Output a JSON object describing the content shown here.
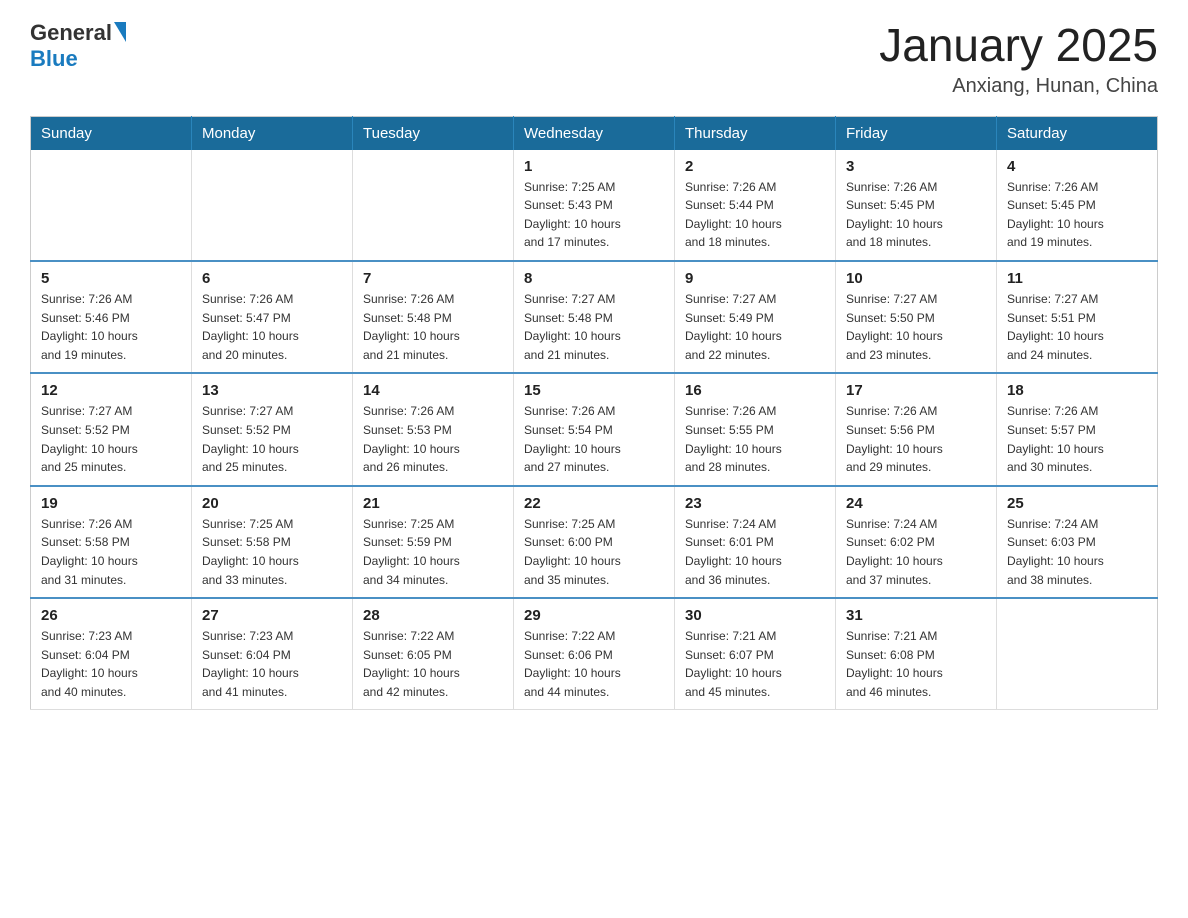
{
  "header": {
    "logo_general": "General",
    "logo_blue": "Blue",
    "title": "January 2025",
    "subtitle": "Anxiang, Hunan, China"
  },
  "days_of_week": [
    "Sunday",
    "Monday",
    "Tuesday",
    "Wednesday",
    "Thursday",
    "Friday",
    "Saturday"
  ],
  "weeks": [
    [
      {
        "day": "",
        "info": ""
      },
      {
        "day": "",
        "info": ""
      },
      {
        "day": "",
        "info": ""
      },
      {
        "day": "1",
        "info": "Sunrise: 7:25 AM\nSunset: 5:43 PM\nDaylight: 10 hours\nand 17 minutes."
      },
      {
        "day": "2",
        "info": "Sunrise: 7:26 AM\nSunset: 5:44 PM\nDaylight: 10 hours\nand 18 minutes."
      },
      {
        "day": "3",
        "info": "Sunrise: 7:26 AM\nSunset: 5:45 PM\nDaylight: 10 hours\nand 18 minutes."
      },
      {
        "day": "4",
        "info": "Sunrise: 7:26 AM\nSunset: 5:45 PM\nDaylight: 10 hours\nand 19 minutes."
      }
    ],
    [
      {
        "day": "5",
        "info": "Sunrise: 7:26 AM\nSunset: 5:46 PM\nDaylight: 10 hours\nand 19 minutes."
      },
      {
        "day": "6",
        "info": "Sunrise: 7:26 AM\nSunset: 5:47 PM\nDaylight: 10 hours\nand 20 minutes."
      },
      {
        "day": "7",
        "info": "Sunrise: 7:26 AM\nSunset: 5:48 PM\nDaylight: 10 hours\nand 21 minutes."
      },
      {
        "day": "8",
        "info": "Sunrise: 7:27 AM\nSunset: 5:48 PM\nDaylight: 10 hours\nand 21 minutes."
      },
      {
        "day": "9",
        "info": "Sunrise: 7:27 AM\nSunset: 5:49 PM\nDaylight: 10 hours\nand 22 minutes."
      },
      {
        "day": "10",
        "info": "Sunrise: 7:27 AM\nSunset: 5:50 PM\nDaylight: 10 hours\nand 23 minutes."
      },
      {
        "day": "11",
        "info": "Sunrise: 7:27 AM\nSunset: 5:51 PM\nDaylight: 10 hours\nand 24 minutes."
      }
    ],
    [
      {
        "day": "12",
        "info": "Sunrise: 7:27 AM\nSunset: 5:52 PM\nDaylight: 10 hours\nand 25 minutes."
      },
      {
        "day": "13",
        "info": "Sunrise: 7:27 AM\nSunset: 5:52 PM\nDaylight: 10 hours\nand 25 minutes."
      },
      {
        "day": "14",
        "info": "Sunrise: 7:26 AM\nSunset: 5:53 PM\nDaylight: 10 hours\nand 26 minutes."
      },
      {
        "day": "15",
        "info": "Sunrise: 7:26 AM\nSunset: 5:54 PM\nDaylight: 10 hours\nand 27 minutes."
      },
      {
        "day": "16",
        "info": "Sunrise: 7:26 AM\nSunset: 5:55 PM\nDaylight: 10 hours\nand 28 minutes."
      },
      {
        "day": "17",
        "info": "Sunrise: 7:26 AM\nSunset: 5:56 PM\nDaylight: 10 hours\nand 29 minutes."
      },
      {
        "day": "18",
        "info": "Sunrise: 7:26 AM\nSunset: 5:57 PM\nDaylight: 10 hours\nand 30 minutes."
      }
    ],
    [
      {
        "day": "19",
        "info": "Sunrise: 7:26 AM\nSunset: 5:58 PM\nDaylight: 10 hours\nand 31 minutes."
      },
      {
        "day": "20",
        "info": "Sunrise: 7:25 AM\nSunset: 5:58 PM\nDaylight: 10 hours\nand 33 minutes."
      },
      {
        "day": "21",
        "info": "Sunrise: 7:25 AM\nSunset: 5:59 PM\nDaylight: 10 hours\nand 34 minutes."
      },
      {
        "day": "22",
        "info": "Sunrise: 7:25 AM\nSunset: 6:00 PM\nDaylight: 10 hours\nand 35 minutes."
      },
      {
        "day": "23",
        "info": "Sunrise: 7:24 AM\nSunset: 6:01 PM\nDaylight: 10 hours\nand 36 minutes."
      },
      {
        "day": "24",
        "info": "Sunrise: 7:24 AM\nSunset: 6:02 PM\nDaylight: 10 hours\nand 37 minutes."
      },
      {
        "day": "25",
        "info": "Sunrise: 7:24 AM\nSunset: 6:03 PM\nDaylight: 10 hours\nand 38 minutes."
      }
    ],
    [
      {
        "day": "26",
        "info": "Sunrise: 7:23 AM\nSunset: 6:04 PM\nDaylight: 10 hours\nand 40 minutes."
      },
      {
        "day": "27",
        "info": "Sunrise: 7:23 AM\nSunset: 6:04 PM\nDaylight: 10 hours\nand 41 minutes."
      },
      {
        "day": "28",
        "info": "Sunrise: 7:22 AM\nSunset: 6:05 PM\nDaylight: 10 hours\nand 42 minutes."
      },
      {
        "day": "29",
        "info": "Sunrise: 7:22 AM\nSunset: 6:06 PM\nDaylight: 10 hours\nand 44 minutes."
      },
      {
        "day": "30",
        "info": "Sunrise: 7:21 AM\nSunset: 6:07 PM\nDaylight: 10 hours\nand 45 minutes."
      },
      {
        "day": "31",
        "info": "Sunrise: 7:21 AM\nSunset: 6:08 PM\nDaylight: 10 hours\nand 46 minutes."
      },
      {
        "day": "",
        "info": ""
      }
    ]
  ]
}
